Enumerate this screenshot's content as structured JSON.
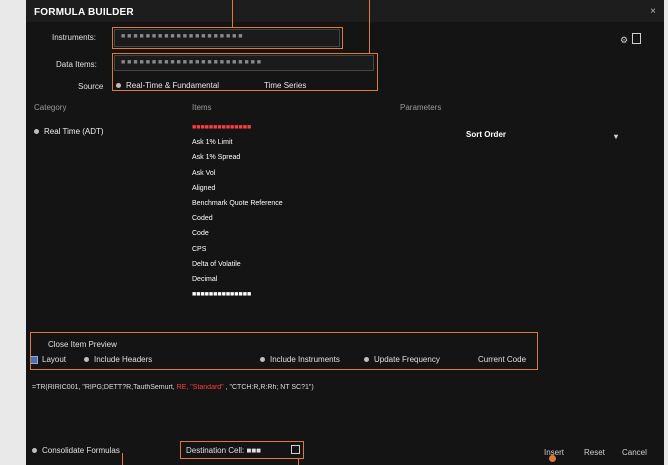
{
  "window": {
    "title": "FORMULA BUILDER",
    "close_glyph": "×"
  },
  "instruments": {
    "label": "Instruments:",
    "value": "■ ■ ■ ■ ■ ■ ■ ■ ■ ■ ■ ■ ■ ■ ■ ■ ■ ■ ■ ■"
  },
  "data_items": {
    "label": "Data Items:",
    "value": "■ ■ ■ ■ ■ ■ ■ ■ ■ ■ ■ ■ ■ ■ ■ ■ ■ ■ ■ ■ ■ ■ ■"
  },
  "source": {
    "label": "Source",
    "options": [
      "Real-Time & Fundamental",
      "Time Series"
    ],
    "selected": 0
  },
  "columns": {
    "category": "Category",
    "items": "Items",
    "parameters": "Parameters"
  },
  "category": {
    "items": [
      "Real Time (ADT)"
    ]
  },
  "functions": {
    "items": [
      "■■■■■■■■■■■■■■",
      "Ask 1% Limit",
      "Ask 1% Spread",
      "Ask Vol",
      "Aligned",
      "Benchmark Quote Reference",
      "Coded",
      "Code",
      "CPS",
      "Delta of Volatile",
      "Decimal",
      "■■■■■■■■■■■■■■"
    ],
    "selected": 0
  },
  "parameters": {
    "sort_order": "Sort Order",
    "caret": "▾"
  },
  "icons": {
    "settings": "gear-icon",
    "copy": "copy-icon"
  },
  "close_item": {
    "header": "Close Item Preview",
    "layout": "Layout",
    "include_headers": "Include Headers",
    "include_instruments": "Include Instruments",
    "update_frequency": "Update Frequency",
    "current_code": "Current Code"
  },
  "formula": {
    "prefix": "=TR(RIRIC001, \"RIPG;DETT?R,TauthSemurt,",
    "highlight": "RE, \"Standard\"",
    "suffix": ", \"CTCH:R,R:Rh; NT SC?1\")"
  },
  "footer": {
    "consolidate": "Consolidate Formulas",
    "destination": "Destination Cell:",
    "destination_value": "■■■",
    "insert": "Insert",
    "reset": "Reset",
    "cancel": "Cancel"
  },
  "colors": {
    "accent": "#e07a2e",
    "background": "#141414",
    "selected_text": "#ff3b3b"
  }
}
